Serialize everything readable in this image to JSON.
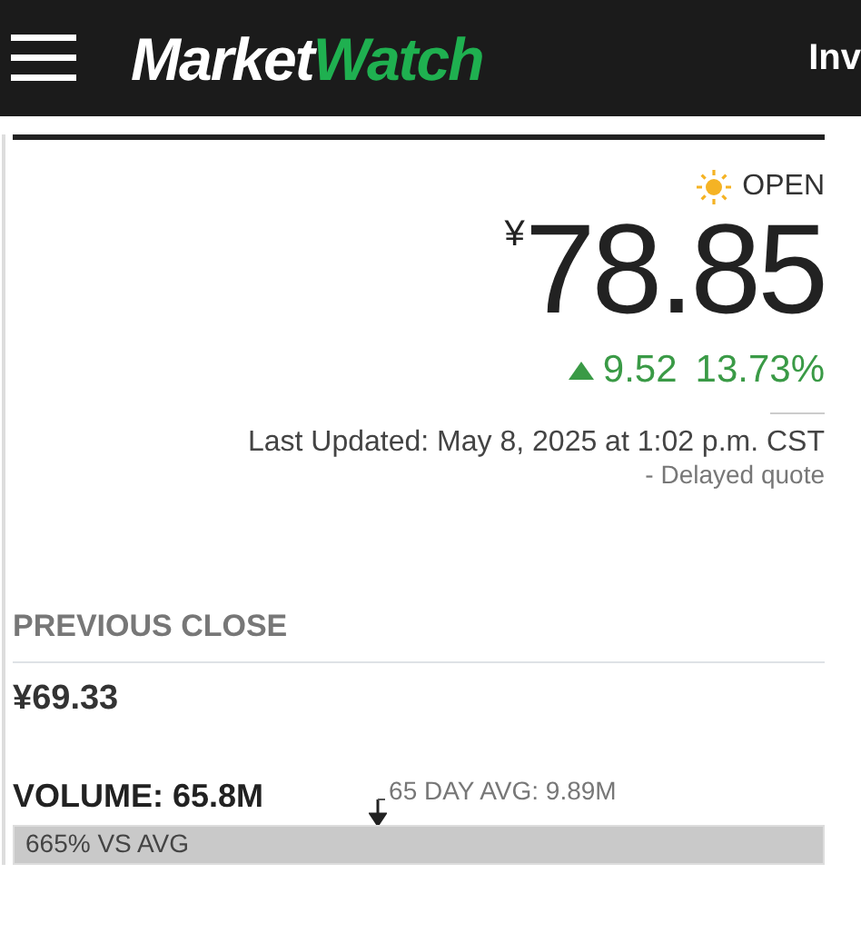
{
  "header": {
    "logo": {
      "part_1": "Market",
      "part_2": "Watch"
    },
    "nav_text": "Inv"
  },
  "quote": {
    "status": "OPEN",
    "market_open": true,
    "currency": "¥",
    "price": "78.85",
    "change": "9.52",
    "change_percent": "13.73%",
    "rising": true,
    "last_updated": "Last Updated: May 8, 2025 at 1:02 p.m. CST",
    "delay_note": "-  Delayed quote"
  },
  "previous_close": {
    "label": "PREVIOUS CLOSE",
    "value": "¥69.33"
  },
  "volume": {
    "label": "VOLUME: 65.8M",
    "avg_label": "65 DAY AVG: 9.89M",
    "bar_text": "665% VS AVG",
    "level": 1
  }
}
